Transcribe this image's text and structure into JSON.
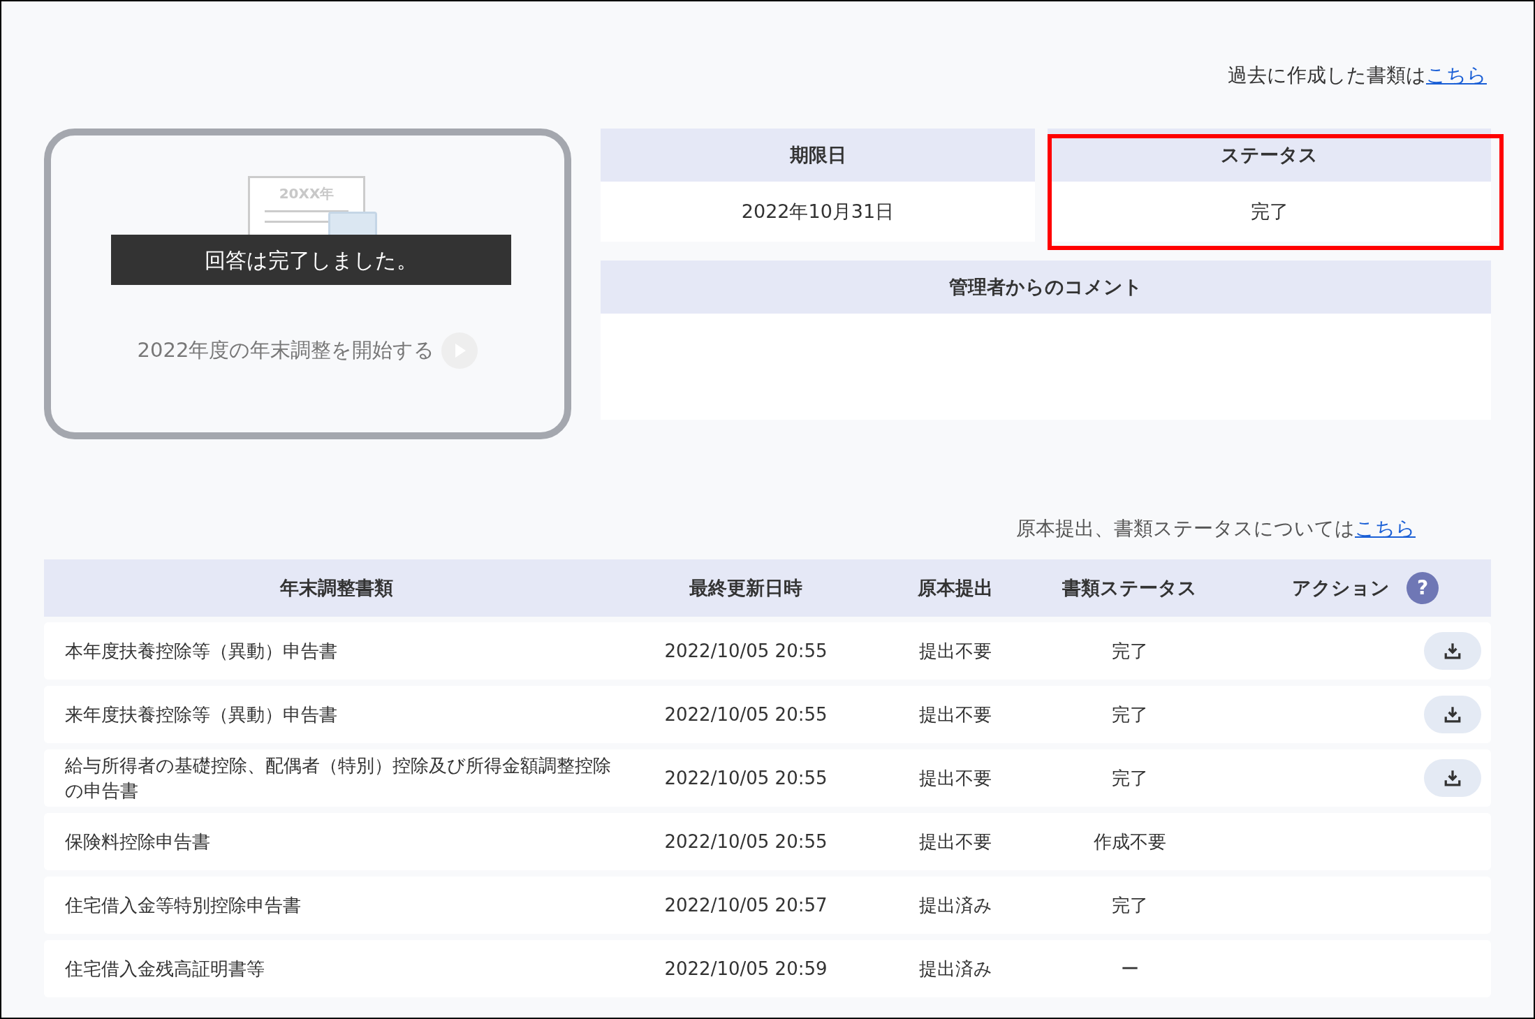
{
  "past_documents": {
    "text": "過去に作成した書類は",
    "link": "こちら"
  },
  "card": {
    "illustration_label": "20XX年",
    "banner": "回答は完了しました。",
    "start_link": "2022年度の年末調整を開始する"
  },
  "deadline": {
    "label": "期限日",
    "value": "2022年10月31日"
  },
  "status": {
    "label": "ステータス",
    "value": "完了",
    "highlighted": true
  },
  "comments": {
    "label": "管理者からのコメント"
  },
  "submission_note": {
    "text": "原本提出、書類ステータスについては",
    "link": "こちら"
  },
  "table": {
    "columns": [
      "年末調整書類",
      "最終更新日時",
      "原本提出",
      "書類ステータス",
      "アクション"
    ],
    "help_icon": "?",
    "rows": [
      {
        "name": "本年度扶養控除等（異動）申告書",
        "updated": "2022/10/05 20:55",
        "original": "提出不要",
        "status": "完了",
        "download": true
      },
      {
        "name": "来年度扶養控除等（異動）申告書",
        "updated": "2022/10/05 20:55",
        "original": "提出不要",
        "status": "完了",
        "download": true
      },
      {
        "name": "給与所得者の基礎控除、配偶者（特別）控除及び所得金額調整控除の申告書",
        "updated": "2022/10/05 20:55",
        "original": "提出不要",
        "status": "完了",
        "download": true
      },
      {
        "name": "保険料控除申告書",
        "updated": "2022/10/05 20:55",
        "original": "提出不要",
        "status": "作成不要",
        "download": false
      },
      {
        "name": "住宅借入金等特別控除申告書",
        "updated": "2022/10/05 20:57",
        "original": "提出済み",
        "status": "完了",
        "download": false
      },
      {
        "name": "住宅借入金残高証明書等",
        "updated": "2022/10/05 20:59",
        "original": "提出済み",
        "status": "ー",
        "download": false
      }
    ]
  }
}
